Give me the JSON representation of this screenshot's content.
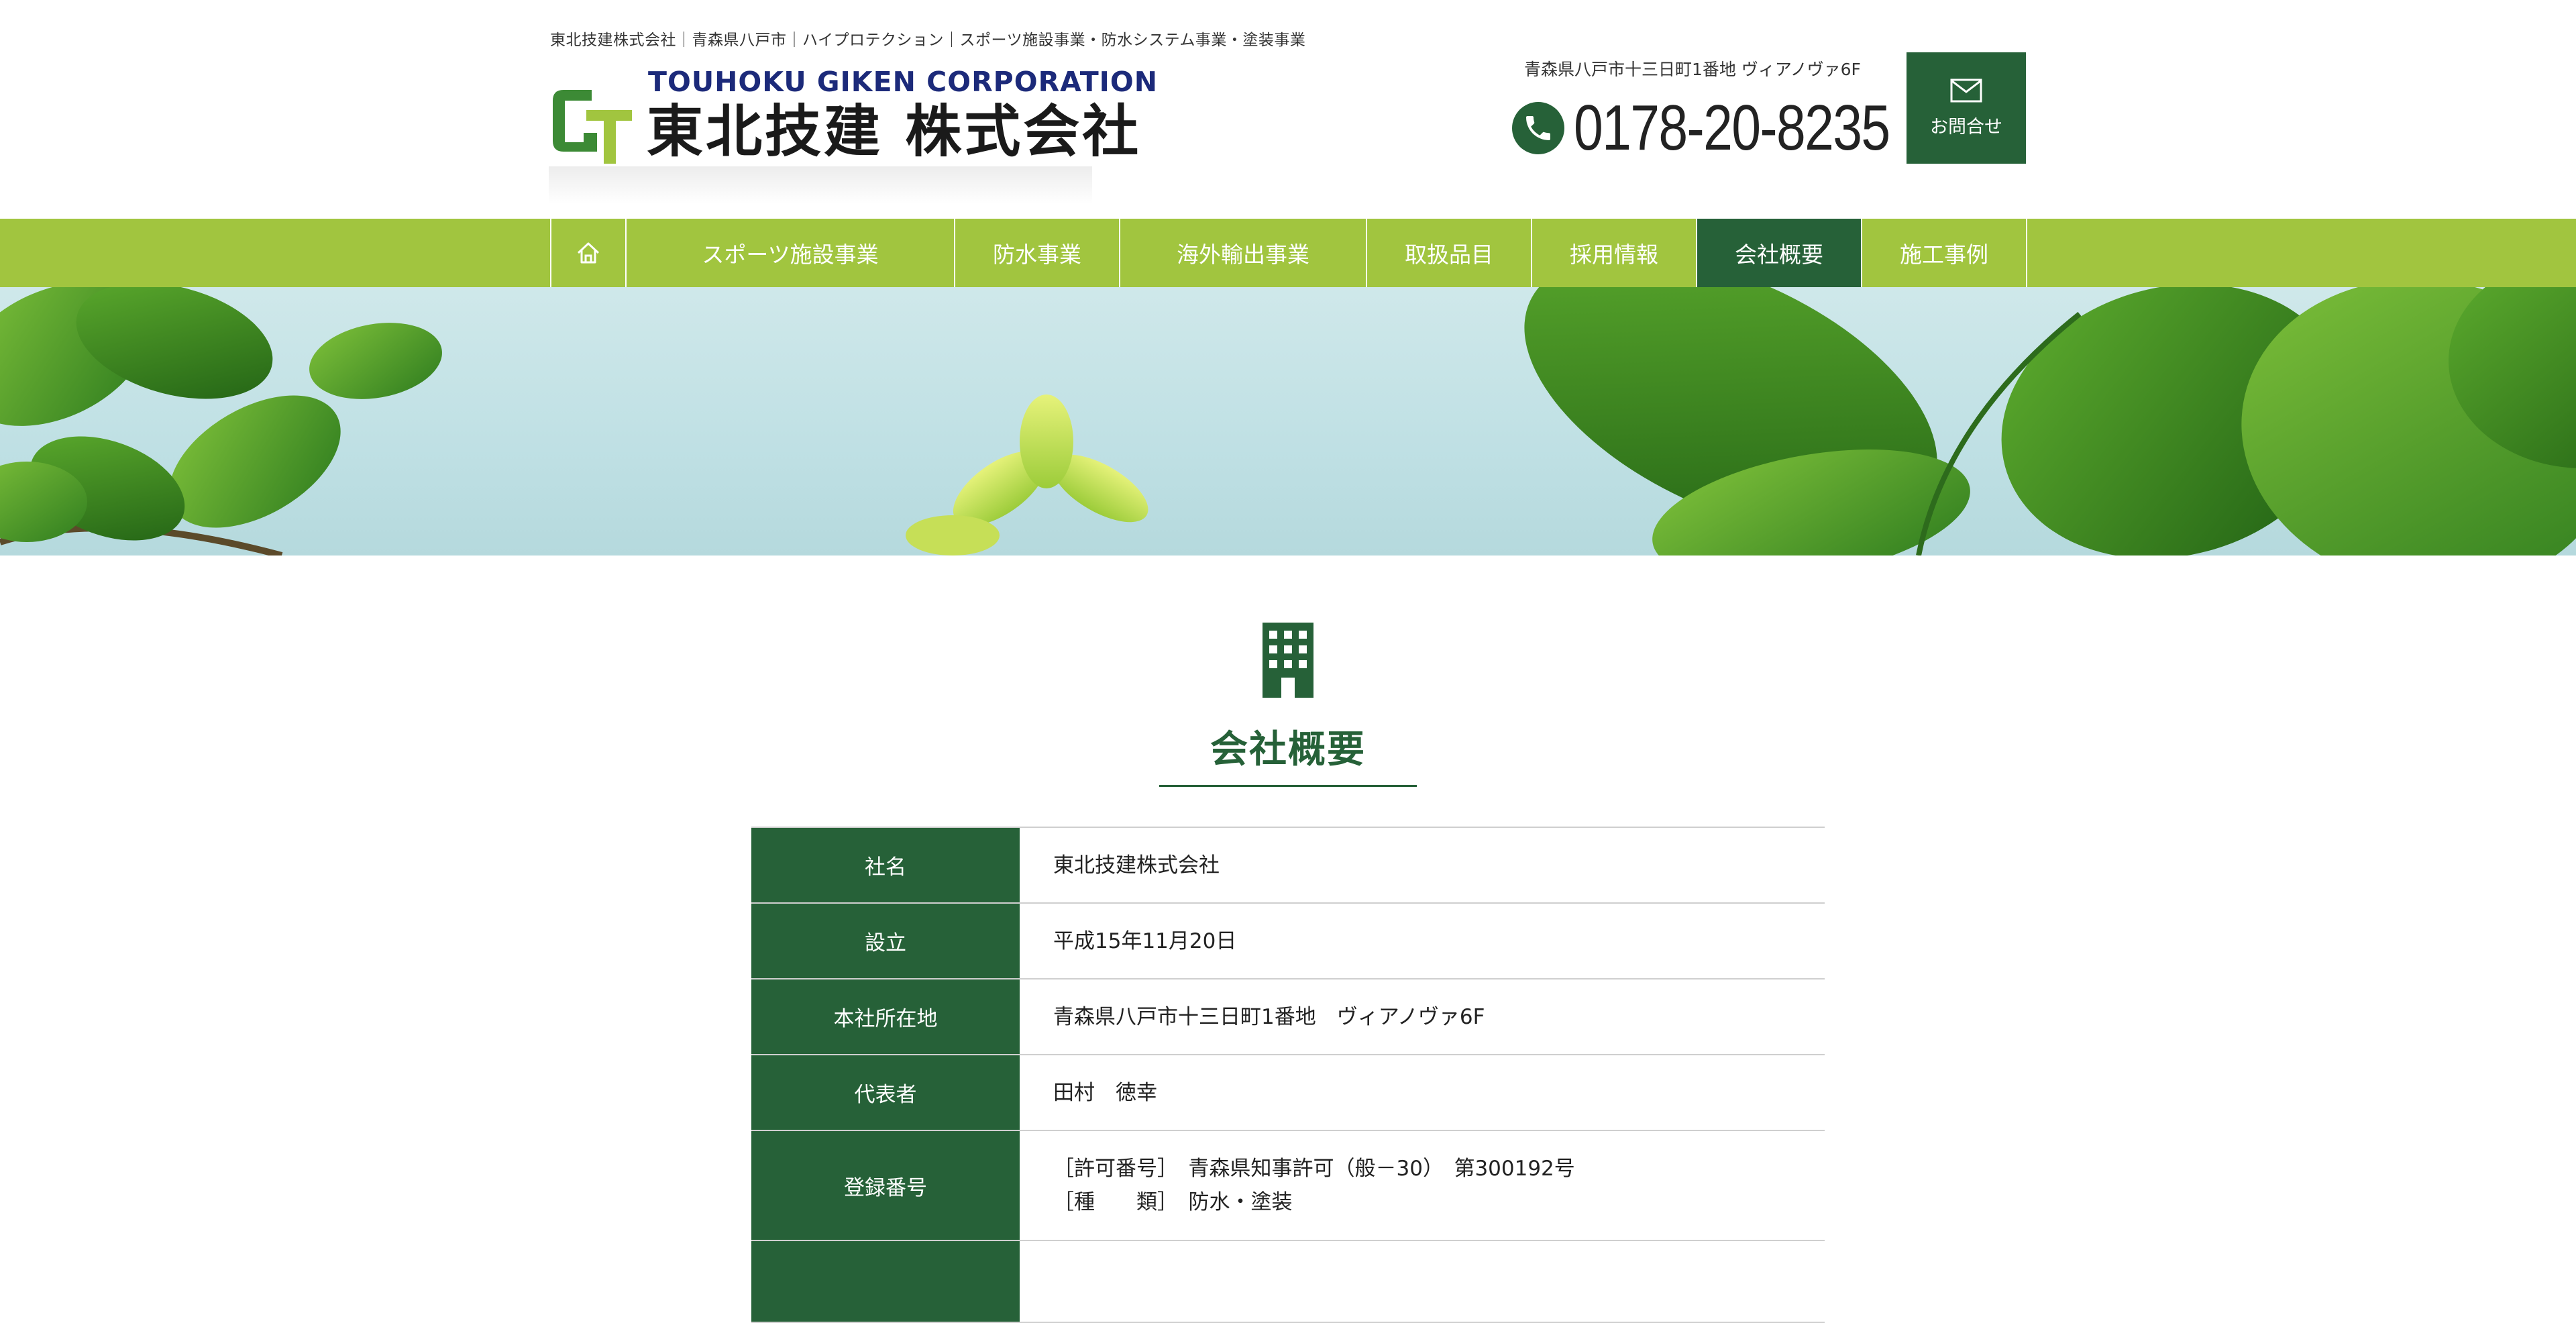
{
  "header": {
    "tagline": "東北技建株式会社｜青森県八戸市｜ハイプロテクション｜スポーツ施設事業・防水システム事業・塗装事業",
    "logo_en": "TOUHOKU GIKEN CORPORATION",
    "logo_ja": "東北技建 株式会社",
    "address": "青森県八戸市十三日町1番地 ヴィアノヴァ6F",
    "phone": "0178-20-8235",
    "contact_label": "お問合せ"
  },
  "nav": {
    "items": [
      {
        "label": "スポーツ施設事業"
      },
      {
        "label": "防水事業"
      },
      {
        "label": "海外輸出事業"
      },
      {
        "label": "取扱品目"
      },
      {
        "label": "採用情報"
      },
      {
        "label": "会社概要"
      },
      {
        "label": "施工事例"
      }
    ],
    "active": "会社概要"
  },
  "section": {
    "title": "会社概要"
  },
  "company": {
    "rows": [
      {
        "label": "社名",
        "lines": [
          "東北技建株式会社"
        ]
      },
      {
        "label": "設立",
        "lines": [
          "平成15年11月20日"
        ]
      },
      {
        "label": "本社所在地",
        "lines": [
          "青森県八戸市十三日町1番地　ヴィアノヴァ6F"
        ]
      },
      {
        "label": "代表者",
        "lines": [
          "田村　徳幸"
        ]
      },
      {
        "label": "登録番号",
        "lines": [
          "［許可番号］　青森県知事許可（般－30）　第300192号",
          "［種　　類］　防水・塗装"
        ]
      }
    ]
  },
  "colors": {
    "brand_green": "#266138",
    "nav_green": "#a1c53f",
    "logo_navy": "#1c2a7a"
  },
  "icons": {
    "home": "home-icon",
    "phone": "phone-icon",
    "mail": "mail-icon",
    "section": "building-icon"
  }
}
